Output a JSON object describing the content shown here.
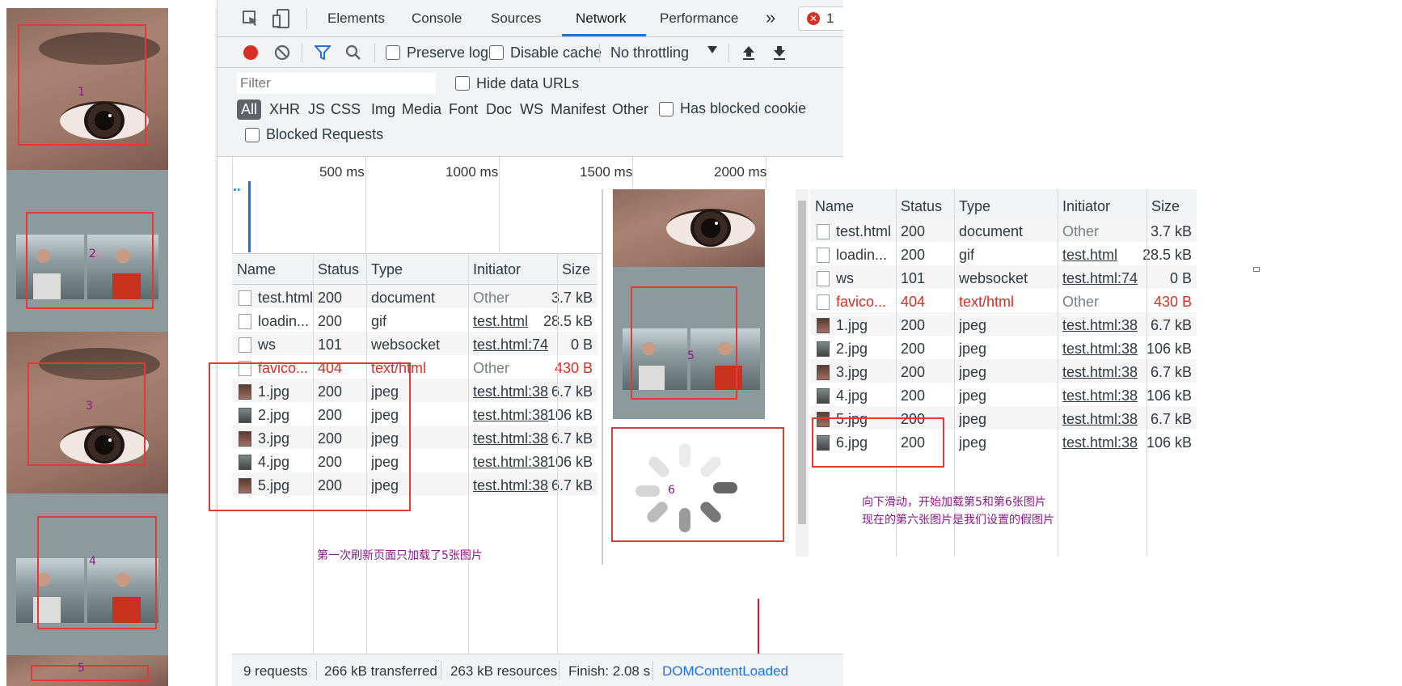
{
  "left_panel": {
    "box_labels": [
      "1",
      "2",
      "3",
      "4",
      "5"
    ]
  },
  "devtools": {
    "tabs": [
      "Elements",
      "Console",
      "Sources",
      "Network",
      "Performance"
    ],
    "more": "»",
    "error_count": "1",
    "toolbar": {
      "preserve_log": "Preserve log",
      "disable_cache": "Disable cache",
      "throttling": "No throttling"
    },
    "filter": {
      "placeholder": "Filter",
      "hide_data_urls": "Hide data URLs",
      "types": [
        "All",
        "XHR",
        "JS",
        "CSS",
        "Img",
        "Media",
        "Font",
        "Doc",
        "WS",
        "Manifest",
        "Other"
      ],
      "has_blocked": "Has blocked cookie",
      "blocked_requests": "Blocked Requests"
    },
    "timeline_ticks": [
      "500 ms",
      "1000 ms",
      "1500 ms",
      "2000 ms"
    ],
    "columns": [
      "Name",
      "Status",
      "Type",
      "Initiator",
      "Size"
    ],
    "rows": [
      {
        "name": "test.html",
        "status": "200",
        "type": "document",
        "initiator": "Other",
        "size": "3.7 kB"
      },
      {
        "name": "loadin...",
        "status": "200",
        "type": "gif",
        "initiator": "test.html",
        "size": "28.5 kB"
      },
      {
        "name": "ws",
        "status": "101",
        "type": "websocket",
        "initiator": "test.html:74",
        "size": "0 B"
      },
      {
        "name": "favico...",
        "status": "404",
        "type": "text/html",
        "initiator": "Other",
        "size": "430 B"
      },
      {
        "name": "1.jpg",
        "status": "200",
        "type": "jpeg",
        "initiator": "test.html:38",
        "size": "6.7 kB"
      },
      {
        "name": "2.jpg",
        "status": "200",
        "type": "jpeg",
        "initiator": "test.html:38",
        "size": "106 kB"
      },
      {
        "name": "3.jpg",
        "status": "200",
        "type": "jpeg",
        "initiator": "test.html:38",
        "size": "6.7 kB"
      },
      {
        "name": "4.jpg",
        "status": "200",
        "type": "jpeg",
        "initiator": "test.html:38",
        "size": "106 kB"
      },
      {
        "name": "5.jpg",
        "status": "200",
        "type": "jpeg",
        "initiator": "test.html:38",
        "size": "6.7 kB"
      }
    ],
    "annotation": "第一次刷新页面只加载了5张图片",
    "statusbar": {
      "requests": "9 requests",
      "transferred": "266 kB transferred",
      "resources": "263 kB resources",
      "finish": "Finish: 2.08 s",
      "dcl": "DOMContentLoaded"
    }
  },
  "middle_panel": {
    "box_labels": [
      "5",
      "6"
    ]
  },
  "right_panel": {
    "columns": [
      "Name",
      "Status",
      "Type",
      "Initiator",
      "Size"
    ],
    "rows": [
      {
        "name": "test.html",
        "status": "200",
        "type": "document",
        "initiator": "Other",
        "size": "3.7 kB"
      },
      {
        "name": "loadin...",
        "status": "200",
        "type": "gif",
        "initiator": "test.html",
        "size": "28.5 kB"
      },
      {
        "name": "ws",
        "status": "101",
        "type": "websocket",
        "initiator": "test.html:74",
        "size": "0 B"
      },
      {
        "name": "favico...",
        "status": "404",
        "type": "text/html",
        "initiator": "Other",
        "size": "430 B"
      },
      {
        "name": "1.jpg",
        "status": "200",
        "type": "jpeg",
        "initiator": "test.html:38",
        "size": "6.7 kB"
      },
      {
        "name": "2.jpg",
        "status": "200",
        "type": "jpeg",
        "initiator": "test.html:38",
        "size": "106 kB"
      },
      {
        "name": "3.jpg",
        "status": "200",
        "type": "jpeg",
        "initiator": "test.html:38",
        "size": "6.7 kB"
      },
      {
        "name": "4.jpg",
        "status": "200",
        "type": "jpeg",
        "initiator": "test.html:38",
        "size": "106 kB"
      },
      {
        "name": "5.jpg",
        "status": "200",
        "type": "jpeg",
        "initiator": "test.html:38",
        "size": "6.7 kB"
      },
      {
        "name": "6.jpg",
        "status": "200",
        "type": "jpeg",
        "initiator": "test.html:38",
        "size": "106 kB"
      }
    ],
    "annotation_line1": "向下滑动，开始加载第5和第6张图片",
    "annotation_line2": "现在的第六张图片是我们设置的假图片"
  }
}
